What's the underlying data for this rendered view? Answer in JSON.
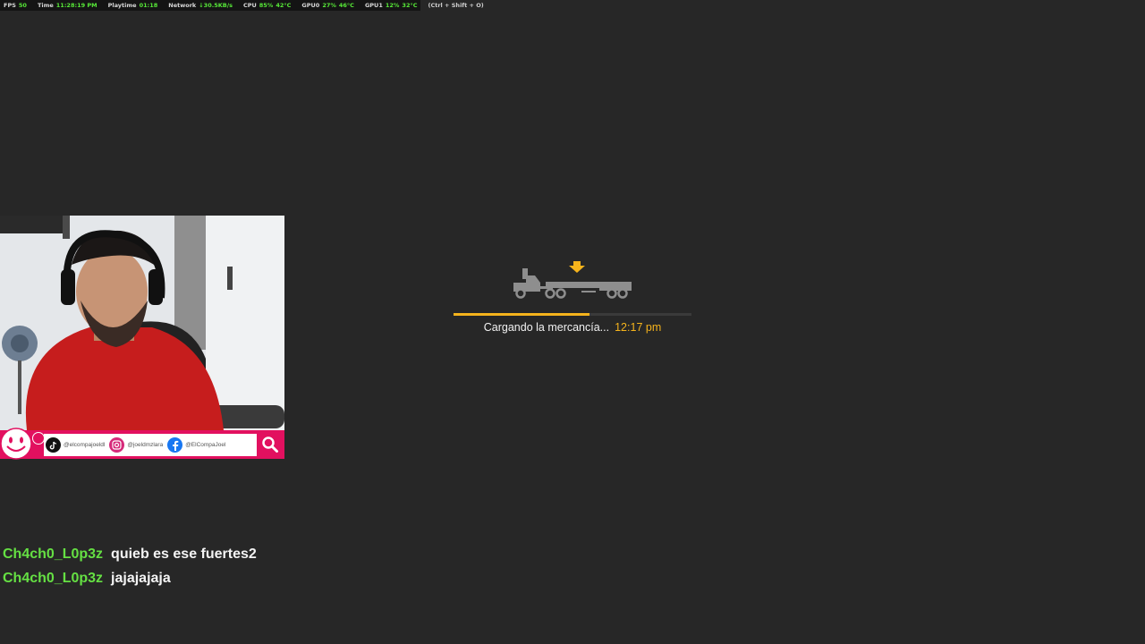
{
  "overlay": {
    "fps": {
      "label": "FPS",
      "value": "50"
    },
    "time": {
      "label": "Time",
      "value": "11:28:19 PM"
    },
    "playtime": {
      "label": "Playtime",
      "value": "01:18"
    },
    "network": {
      "label": "Network",
      "value": "↓30.5KB/s"
    },
    "cpu": {
      "label": "CPU",
      "usage": "85%",
      "temp": "42°C"
    },
    "gpu0": {
      "label": "GPU0",
      "usage": "27%",
      "temp": "46°C"
    },
    "gpu1": {
      "label": "GPU1",
      "usage": "12%",
      "temp": "32°C"
    },
    "hotkey_hint": "(Ctrl + Shift + O)"
  },
  "loading": {
    "text": "Cargando la mercancía...",
    "time": "12:17 pm",
    "progress": 0.57,
    "accent_color": "#f5b31c",
    "icon": "truck-trailer-icon"
  },
  "social": {
    "handles": [
      {
        "platform": "tiktok",
        "icon": "tiktok-icon",
        "handle": "@elcompajoeldl"
      },
      {
        "platform": "instagram",
        "icon": "instagram-icon",
        "handle": "@joeldmzlara"
      },
      {
        "platform": "facebook",
        "icon": "facebook-icon",
        "handle": "@ElCompaJoel"
      }
    ],
    "brand_color": "#e2105f"
  },
  "chat": {
    "messages": [
      {
        "user": "Ch4ch0_L0p3z",
        "text": "quieb es ese fuertes2"
      },
      {
        "user": "Ch4ch0_L0p3z",
        "text": "jajajajaja"
      }
    ],
    "username_color": "#65e043"
  }
}
